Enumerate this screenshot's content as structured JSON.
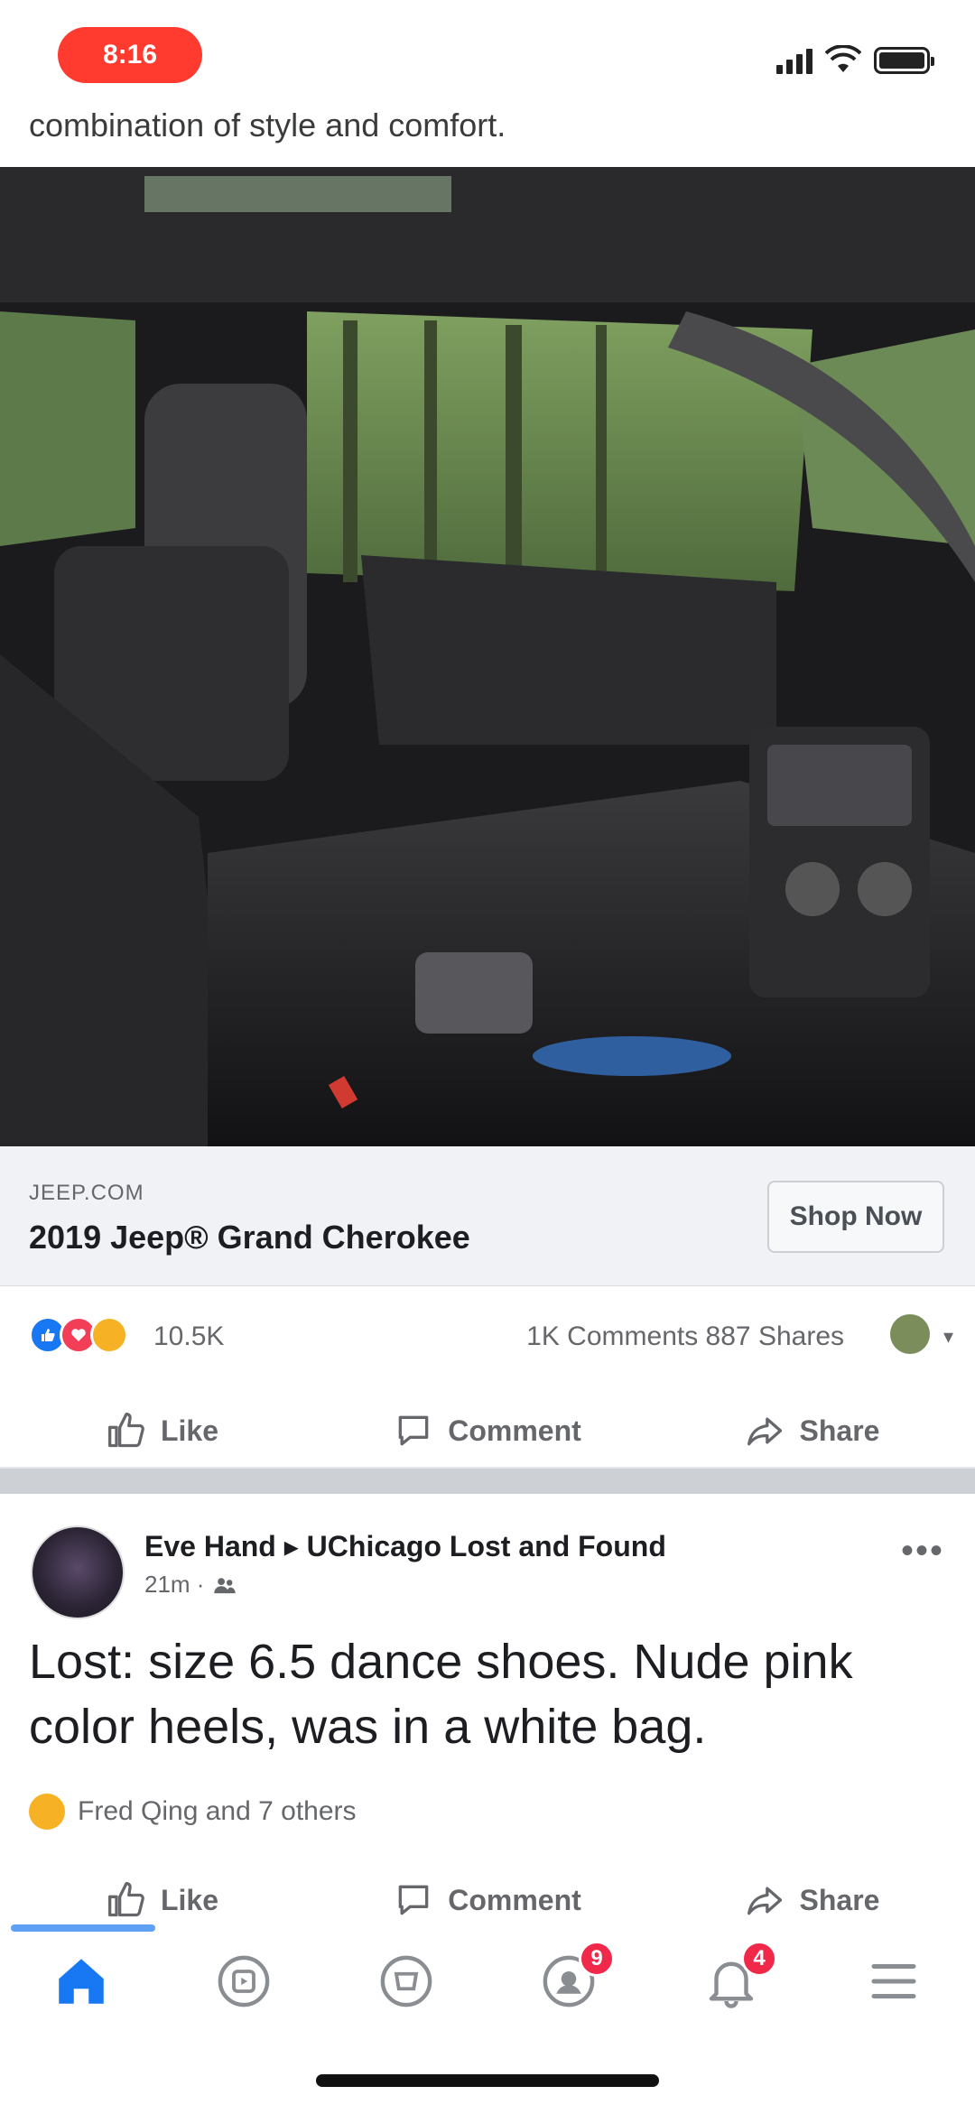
{
  "status_bar": {
    "time": "8:16"
  },
  "ad": {
    "caption": "combination of style and comfort.",
    "domain": "JEEP.COM",
    "headline": "2019 Jeep® Grand Cherokee",
    "cta_label": "Shop Now",
    "reactions": {
      "count": "10.5K",
      "engagement": "1K Comments  887 Shares"
    },
    "actions": {
      "like": "Like",
      "comment": "Comment",
      "share": "Share"
    }
  },
  "post": {
    "author": "Eve Hand ▸ UChicago Lost and Found",
    "time": "21m ·",
    "text": "Lost: size 6.5 dance shoes. Nude pink color heels, was in a white bag.",
    "reactions_text": "Fred Qing and 7 others",
    "actions": {
      "like": "Like",
      "comment": "Comment",
      "share": "Share"
    }
  },
  "tabs": [
    {
      "name": "home",
      "badge": ""
    },
    {
      "name": "watch",
      "badge": ""
    },
    {
      "name": "marketplace",
      "badge": ""
    },
    {
      "name": "groups",
      "badge": "9"
    },
    {
      "name": "notifications",
      "badge": "4"
    },
    {
      "name": "menu",
      "badge": ""
    }
  ],
  "colors": {
    "accent": "#1877f2",
    "badge": "#f02849",
    "time_pill": "#ff3b30"
  }
}
